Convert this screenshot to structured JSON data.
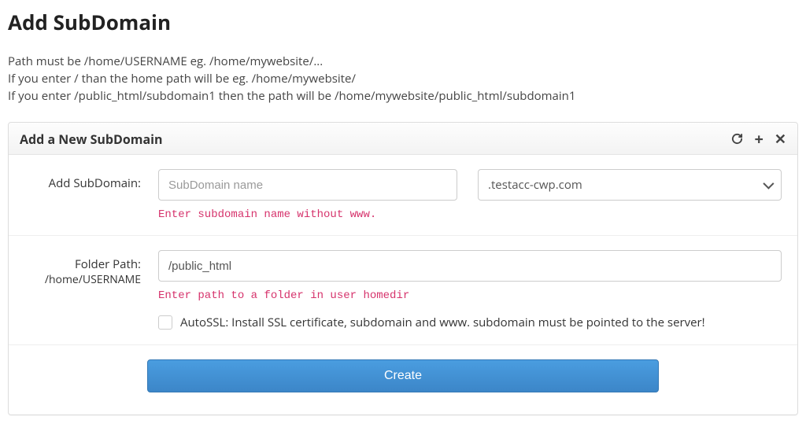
{
  "page": {
    "title": "Add SubDomain",
    "intro_line1": "Path must be /home/USERNAME eg. /home/mywebsite/...",
    "intro_line2": "If you enter / than the home path will be eg. /home/mywebsite/",
    "intro_line3": "If you enter /public_html/subdomain1 then the path will be /home/mywebsite/public_html/subdomain1"
  },
  "panel": {
    "title": "Add a New SubDomain"
  },
  "form": {
    "subdomain": {
      "label": "Add SubDomain:",
      "placeholder": "SubDomain name",
      "value": "",
      "hint": "Enter subdomain name without www.",
      "domain_selected": ".testacc-cwp.com"
    },
    "folder": {
      "label": "Folder Path:",
      "sublabel": "/home/USERNAME",
      "value": "/public_html",
      "hint": "Enter path to a folder in user homedir"
    },
    "autossl": {
      "checked": false,
      "label": "AutoSSL: Install SSL certificate, subdomain and www. subdomain must be pointed to the server!"
    },
    "create_label": "Create"
  }
}
